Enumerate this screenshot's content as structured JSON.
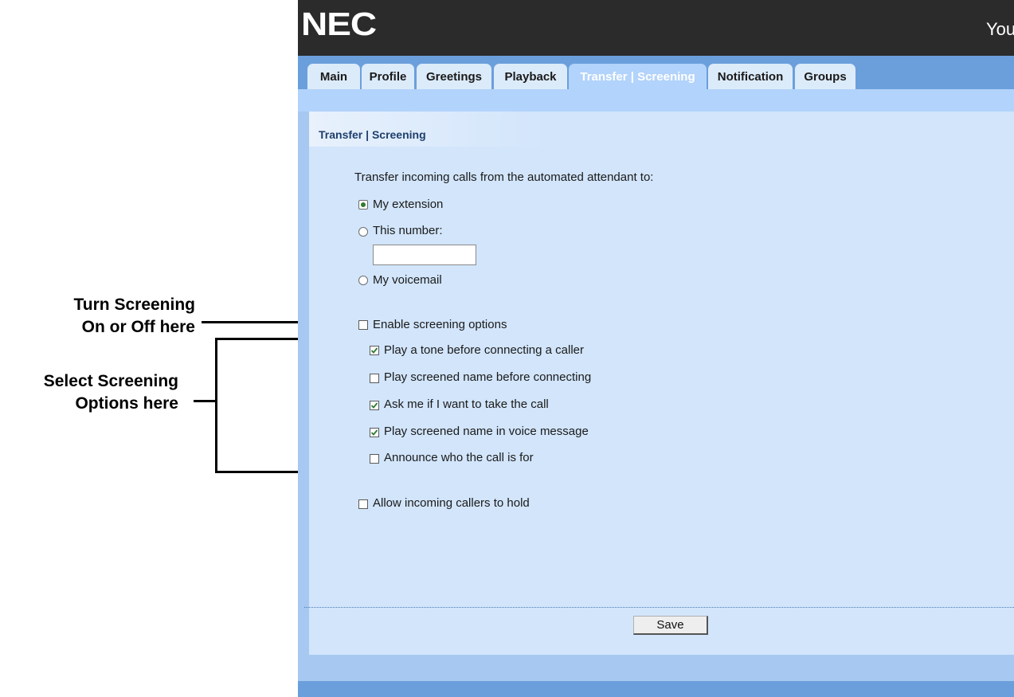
{
  "annotations": {
    "screening_toggle": {
      "line1": "Turn  Screening",
      "line2": "On or Off here"
    },
    "screening_options": {
      "line1": "Select Screening",
      "line2": "Options here"
    }
  },
  "header": {
    "logo": "NEC",
    "user_text": "You"
  },
  "tabs": [
    {
      "label": "Main",
      "active": false
    },
    {
      "label": "Profile",
      "active": false
    },
    {
      "label": "Greetings",
      "active": false
    },
    {
      "label": "Playback",
      "active": false
    },
    {
      "label": "Transfer | Screening",
      "active": true
    },
    {
      "label": "Notification",
      "active": false
    },
    {
      "label": "Groups",
      "active": false
    }
  ],
  "panel": {
    "title": "Transfer | Screening",
    "transfer_prompt": "Transfer incoming calls from the automated attendant to:",
    "transfer_options": [
      {
        "label": "My extension",
        "selected": true
      },
      {
        "label": "This number:",
        "selected": false
      },
      {
        "label": "My voicemail",
        "selected": false
      }
    ],
    "this_number_value": "",
    "enable_screening": {
      "label": "Enable screening options",
      "checked": false
    },
    "screening_options": [
      {
        "label": "Play a tone before connecting a caller",
        "checked": true
      },
      {
        "label": "Play screened name before connecting",
        "checked": false
      },
      {
        "label": "Ask me if I want to take the call",
        "checked": true
      },
      {
        "label": "Play screened name in voice message",
        "checked": true
      },
      {
        "label": "Announce who the call is for",
        "checked": false
      }
    ],
    "allow_hold": {
      "label": "Allow incoming callers to hold",
      "checked": false
    },
    "save_label": "Save"
  },
  "colors": {
    "header_bg": "#2b2b2b",
    "tabbar_bg": "#6b9fdc",
    "tab_bg": "#dcebfa",
    "active_tab_bg": "#b2d3fb",
    "panel_bg": "#d2e5fb",
    "title_text": "#1f3f6c",
    "check_green": "#2f7a2f"
  }
}
